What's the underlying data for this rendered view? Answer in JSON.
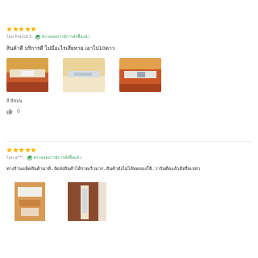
{
  "reviews": [
    {
      "rating": 5,
      "author": "โดย Prarod S.",
      "verified_label": "ตรวจสอบว่ามีการสั่งซื้อแล้ว",
      "text": "สินค้าดี บริการดี ไม่มีอะไรเสียหาย เอาไป10ดาว",
      "photos": [
        "photo-1",
        "photo-2",
        "photo-3"
      ],
      "variant": "สี:สีหม่น",
      "likes": "0"
    },
    {
      "rating": 5,
      "author": "โดย a***.",
      "verified_label": "ตรวจสอบว่ามีการสั่งซื้อแล้ว",
      "text": "ทางร้านแพ็คสินค้ามาดี..จัดส่งสินค้าได้รวดเร็วมาก..สินค้ายังไม่ได้ทดลองใช้..วารันตีดแล้วดีหรือเปล่า",
      "photos": [
        "photo-1",
        "photo-2"
      ]
    }
  ],
  "colors": {
    "star": "#f7b500",
    "verified": "#3aa55b"
  },
  "icons": {
    "star": "star-icon",
    "verified": "check-circle-icon",
    "like": "thumbs-up-icon"
  }
}
